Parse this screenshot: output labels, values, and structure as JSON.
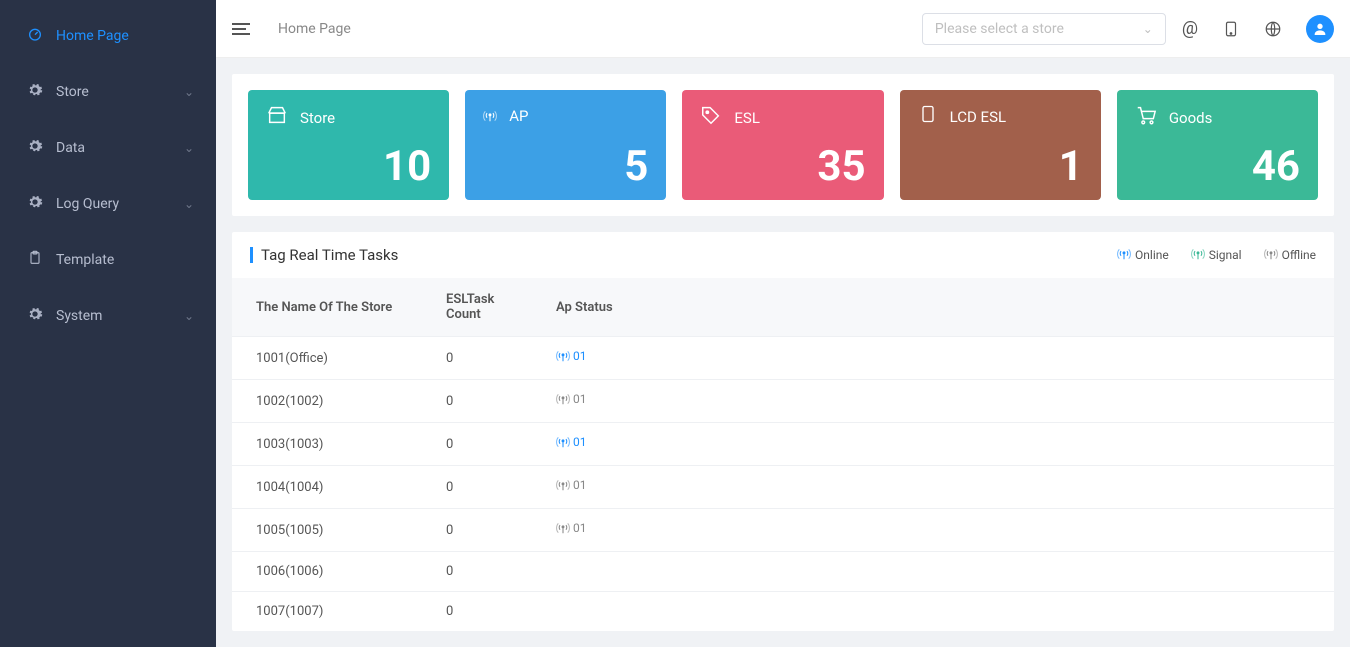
{
  "sidebar": {
    "items": [
      {
        "label": "Home Page",
        "icon": "dashboard",
        "active": true,
        "children": false
      },
      {
        "label": "Store",
        "icon": "gear",
        "active": false,
        "children": true
      },
      {
        "label": "Data",
        "icon": "gear",
        "active": false,
        "children": true
      },
      {
        "label": "Log Query",
        "icon": "gear",
        "active": false,
        "children": true
      },
      {
        "label": "Template",
        "icon": "clipboard",
        "active": false,
        "children": false
      },
      {
        "label": "System",
        "icon": "gear",
        "active": false,
        "children": true
      }
    ]
  },
  "topbar": {
    "breadcrumb": "Home Page",
    "store_select_placeholder": "Please select a store"
  },
  "stats": [
    {
      "label": "Store",
      "value": "10",
      "color": "teal",
      "icon": "store"
    },
    {
      "label": "AP",
      "value": "5",
      "color": "blue",
      "icon": "antenna"
    },
    {
      "label": "ESL",
      "value": "35",
      "color": "red",
      "icon": "tag"
    },
    {
      "label": "LCD ESL",
      "value": "1",
      "color": "brown",
      "icon": "phone"
    },
    {
      "label": "Goods",
      "value": "46",
      "color": "green",
      "icon": "cart"
    }
  ],
  "task": {
    "title": "Tag Real Time Tasks",
    "legend": {
      "online": "Online",
      "signal": "Signal",
      "offline": "Offline"
    },
    "columns": {
      "store": "The Name Of The Store",
      "count": "ESLTask Count",
      "status": "Ap Status"
    },
    "rows": [
      {
        "store": "1001(Office)",
        "count": "0",
        "ap_num": "01",
        "ap_online": true
      },
      {
        "store": "1002(1002)",
        "count": "0",
        "ap_num": "01",
        "ap_online": false
      },
      {
        "store": "1003(1003)",
        "count": "0",
        "ap_num": "01",
        "ap_online": true
      },
      {
        "store": "1004(1004)",
        "count": "0",
        "ap_num": "01",
        "ap_online": false
      },
      {
        "store": "1005(1005)",
        "count": "0",
        "ap_num": "01",
        "ap_online": false
      },
      {
        "store": "1006(1006)",
        "count": "0",
        "ap_num": "",
        "ap_online": null
      },
      {
        "store": "1007(1007)",
        "count": "0",
        "ap_num": "",
        "ap_online": null
      }
    ]
  }
}
